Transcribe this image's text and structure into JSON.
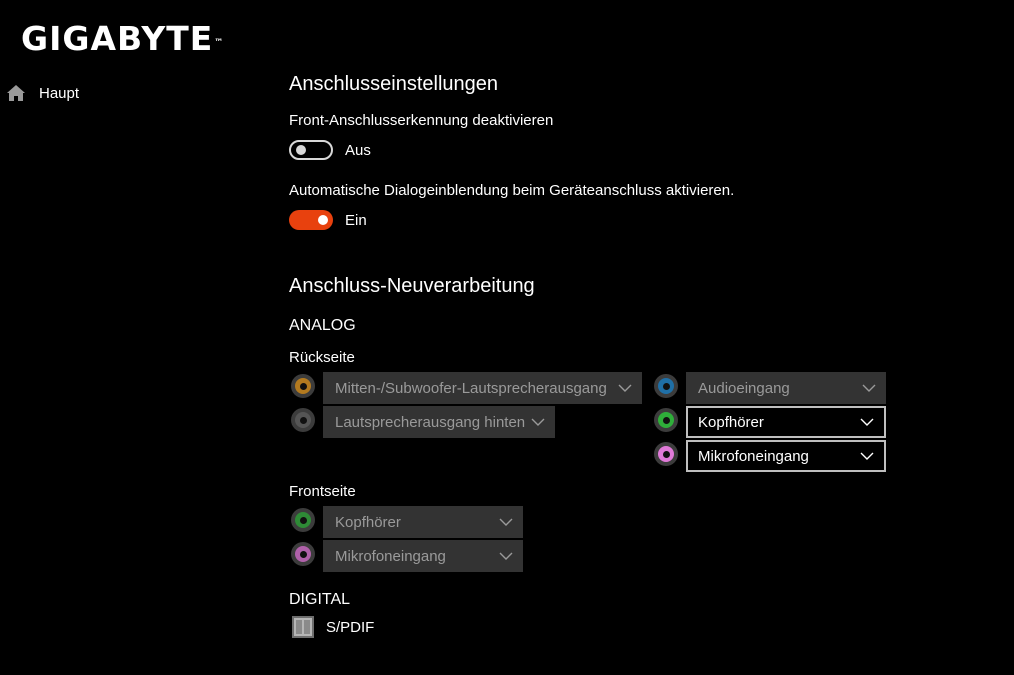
{
  "brand": {
    "logo_text": "GIGABYTE",
    "trademark": "™"
  },
  "sidebar": {
    "items": [
      {
        "label": "Haupt",
        "icon": "home-icon"
      }
    ]
  },
  "connection_settings": {
    "title": "Anschlusseinstellungen",
    "front_detection": {
      "label": "Front-Anschlusserkennung deaktivieren",
      "state": "Aus",
      "on": false
    },
    "auto_dialog": {
      "label": "Automatische Dialogeinblendung beim Geräteanschluss aktivieren.",
      "state": "Ein",
      "on": true
    }
  },
  "retasking": {
    "title": "Anschluss-Neuverarbeitung",
    "analog": {
      "title": "ANALOG",
      "rear": {
        "title": "Rückseite",
        "jacks": [
          {
            "color": "#b37a1f",
            "value": "Mitten-/Subwoofer-Lautsprecherausgang",
            "enabled": false
          },
          {
            "color": "#555555",
            "value": "Lautsprecherausgang hinten",
            "enabled": false
          },
          {
            "color": "#1f6fa6",
            "value": "Audioeingang",
            "enabled": false
          },
          {
            "color": "#2fae3a",
            "value": "Kopfhörer",
            "enabled": true
          },
          {
            "color": "#e07ad8",
            "value": "Mikrofoneingang",
            "enabled": true
          }
        ]
      },
      "front": {
        "title": "Frontseite",
        "jacks": [
          {
            "color": "#2e8a36",
            "value": "Kopfhörer",
            "enabled": false
          },
          {
            "color": "#b061aa",
            "value": "Mikrofoneingang",
            "enabled": false
          }
        ]
      }
    },
    "digital": {
      "title": "DIGITAL",
      "spdif_label": "S/PDIF",
      "icon": "spdif-port-icon"
    }
  },
  "colors": {
    "accent": "#e8410e",
    "background": "#000000",
    "select_disabled": "#333333"
  }
}
